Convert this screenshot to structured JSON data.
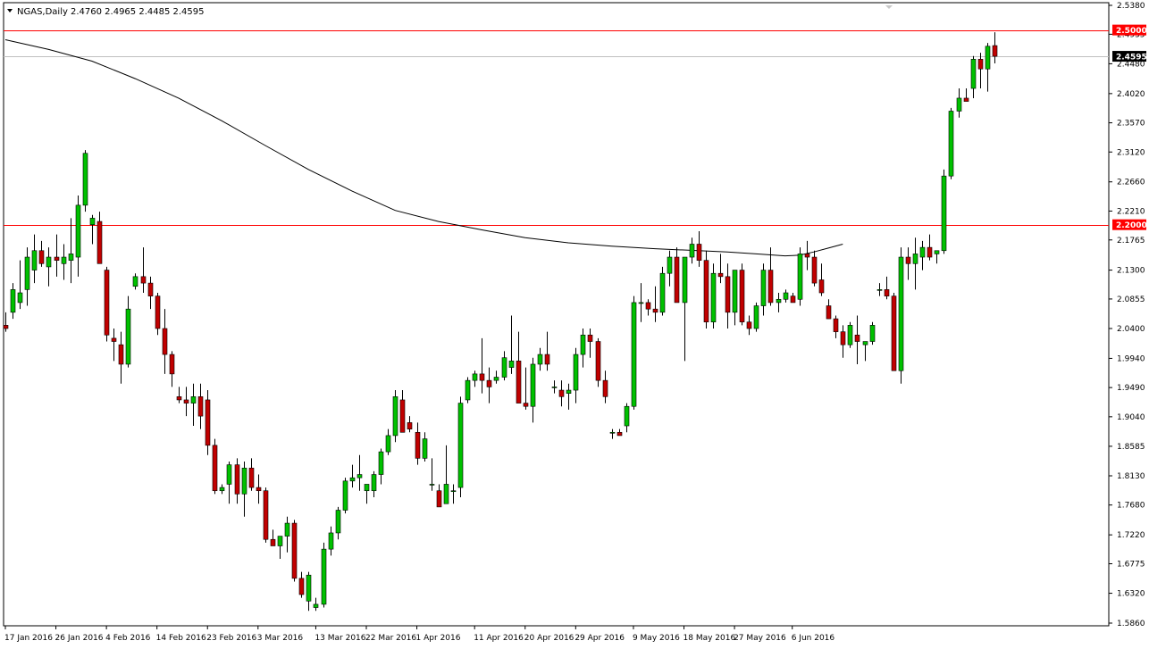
{
  "chart_data": {
    "type": "candlestick",
    "symbol_header": "NGAS,Daily",
    "ohlc_header": "2.4760 2.4965 2.4485 2.4595",
    "y_axis": {
      "ticks": [
        "2.5380",
        "2.4935",
        "2.4480",
        "2.4020",
        "2.3570",
        "2.3120",
        "2.2660",
        "2.2210",
        "2.1765",
        "2.1300",
        "2.0855",
        "2.0400",
        "1.9940",
        "1.9490",
        "1.9040",
        "1.8585",
        "1.8130",
        "1.7680",
        "1.7220",
        "1.6775",
        "1.6320",
        "1.5860"
      ],
      "range": [
        1.586,
        2.538
      ]
    },
    "x_axis": {
      "labels": [
        {
          "text": "17 Jan 2016",
          "index": 0
        },
        {
          "text": "26 Jan 2016",
          "index": 7
        },
        {
          "text": "4 Feb 2016",
          "index": 14
        },
        {
          "text": "14 Feb 2016",
          "index": 21
        },
        {
          "text": "23 Feb 2016",
          "index": 28
        },
        {
          "text": "3 Mar 2016",
          "index": 35
        },
        {
          "text": "13 Mar 2016",
          "index": 43
        },
        {
          "text": "22 Mar 2016",
          "index": 50
        },
        {
          "text": "1 Apr 2016",
          "index": 57
        },
        {
          "text": "11 Apr 2016",
          "index": 65
        },
        {
          "text": "20 Apr 2016",
          "index": 72
        },
        {
          "text": "29 Apr 2016",
          "index": 79
        },
        {
          "text": "9 May 2016",
          "index": 87
        },
        {
          "text": "18 May 2016",
          "index": 94
        },
        {
          "text": "27 May 2016",
          "index": 101
        },
        {
          "text": "6 Jun 2016",
          "index": 109
        }
      ]
    },
    "horizontal_lines": [
      {
        "price": 2.5,
        "label": "2.5000",
        "color": "#ff0000",
        "label_bg": "#ff0000",
        "label_color": "#ffffff"
      },
      {
        "price": 2.2,
        "label": "2.2000",
        "color": "#ff0000",
        "label_bg": "#ff0000",
        "label_color": "#ffffff"
      },
      {
        "price": 2.4595,
        "label": "2.4595",
        "color": "#c0c0c0",
        "label_bg": "#000000",
        "label_color": "#ffffff"
      }
    ],
    "colors": {
      "bull": "#00c000",
      "bear": "#c00000",
      "wick": "#000000",
      "ma": "#000000",
      "background": "#ffffff"
    },
    "candles": [
      [
        2.045,
        2.065,
        2.035,
        2.04
      ],
      [
        2.065,
        2.11,
        2.055,
        2.1
      ],
      [
        2.08,
        2.145,
        2.07,
        2.095
      ],
      [
        2.1,
        2.165,
        2.075,
        2.15
      ],
      [
        2.13,
        2.185,
        2.11,
        2.16
      ],
      [
        2.16,
        2.175,
        2.135,
        2.14
      ],
      [
        2.135,
        2.165,
        2.105,
        2.15
      ],
      [
        2.15,
        2.185,
        2.12,
        2.145
      ],
      [
        2.14,
        2.17,
        2.115,
        2.15
      ],
      [
        2.145,
        2.21,
        2.11,
        2.155
      ],
      [
        2.15,
        2.245,
        2.12,
        2.23
      ],
      [
        2.23,
        2.315,
        2.22,
        2.31
      ],
      [
        2.2,
        2.215,
        2.17,
        2.21
      ],
      [
        2.205,
        2.22,
        2.14,
        2.14
      ],
      [
        2.13,
        2.135,
        2.02,
        2.03
      ],
      [
        2.025,
        2.04,
        1.99,
        2.02
      ],
      [
        2.015,
        2.035,
        1.955,
        1.985
      ],
      [
        1.985,
        2.09,
        1.98,
        2.07
      ],
      [
        2.105,
        2.125,
        2.1,
        2.12
      ],
      [
        2.12,
        2.165,
        2.095,
        2.11
      ],
      [
        2.11,
        2.12,
        2.07,
        2.09
      ],
      [
        2.09,
        2.095,
        2.03,
        2.04
      ],
      [
        2.04,
        2.07,
        1.97,
        2.0
      ],
      [
        2.0,
        2.005,
        1.95,
        1.97
      ],
      [
        1.935,
        1.95,
        1.925,
        1.93
      ],
      [
        1.93,
        1.95,
        1.905,
        1.925
      ],
      [
        1.925,
        1.955,
        1.89,
        1.935
      ],
      [
        1.935,
        1.955,
        1.885,
        1.905
      ],
      [
        1.93,
        1.945,
        1.845,
        1.86
      ],
      [
        1.86,
        1.87,
        1.785,
        1.79
      ],
      [
        1.79,
        1.8,
        1.785,
        1.795
      ],
      [
        1.8,
        1.835,
        1.77,
        1.83
      ],
      [
        1.83,
        1.84,
        1.77,
        1.785
      ],
      [
        1.785,
        1.835,
        1.75,
        1.825
      ],
      [
        1.825,
        1.84,
        1.79,
        1.795
      ],
      [
        1.795,
        1.815,
        1.77,
        1.79
      ],
      [
        1.79,
        1.795,
        1.71,
        1.715
      ],
      [
        1.715,
        1.73,
        1.705,
        1.705
      ],
      [
        1.705,
        1.715,
        1.685,
        1.72
      ],
      [
        1.72,
        1.75,
        1.695,
        1.74
      ],
      [
        1.74,
        1.745,
        1.65,
        1.655
      ],
      [
        1.655,
        1.665,
        1.625,
        1.63
      ],
      [
        1.62,
        1.665,
        1.605,
        1.66
      ],
      [
        1.61,
        1.625,
        1.605,
        1.615
      ],
      [
        1.615,
        1.71,
        1.61,
        1.7
      ],
      [
        1.7,
        1.735,
        1.69,
        1.725
      ],
      [
        1.725,
        1.765,
        1.715,
        1.76
      ],
      [
        1.76,
        1.81,
        1.755,
        1.805
      ],
      [
        1.805,
        1.83,
        1.795,
        1.81
      ],
      [
        1.81,
        1.845,
        1.79,
        1.815
      ],
      [
        1.79,
        1.8,
        1.77,
        1.8
      ],
      [
        1.79,
        1.82,
        1.78,
        1.815
      ],
      [
        1.815,
        1.855,
        1.8,
        1.85
      ],
      [
        1.85,
        1.885,
        1.845,
        1.875
      ],
      [
        1.875,
        1.945,
        1.865,
        1.935
      ],
      [
        1.93,
        1.945,
        1.88,
        1.88
      ],
      [
        1.895,
        1.905,
        1.88,
        1.885
      ],
      [
        1.88,
        1.895,
        1.83,
        1.84
      ],
      [
        1.84,
        1.88,
        1.835,
        1.87
      ],
      [
        1.8,
        1.84,
        1.79,
        1.8
      ],
      [
        1.79,
        1.8,
        1.765,
        1.765
      ],
      [
        1.77,
        1.86,
        1.77,
        1.8
      ],
      [
        1.79,
        1.8,
        1.77,
        1.79
      ],
      [
        1.795,
        1.935,
        1.78,
        1.925
      ],
      [
        1.93,
        1.965,
        1.925,
        1.96
      ],
      [
        1.96,
        1.975,
        1.95,
        1.97
      ],
      [
        1.97,
        2.025,
        1.94,
        1.96
      ],
      [
        1.96,
        1.98,
        1.925,
        1.95
      ],
      [
        1.96,
        1.975,
        1.955,
        1.965
      ],
      [
        1.965,
        2.005,
        1.96,
        1.995
      ],
      [
        1.98,
        2.06,
        1.97,
        1.99
      ],
      [
        1.99,
        2.035,
        1.93,
        1.925
      ],
      [
        1.925,
        1.98,
        1.915,
        1.92
      ],
      [
        1.92,
        1.995,
        1.895,
        1.985
      ],
      [
        1.985,
        2.01,
        1.975,
        2.0
      ],
      [
        2.0,
        2.035,
        1.975,
        1.985
      ],
      [
        1.95,
        1.96,
        1.94,
        1.95
      ],
      [
        1.945,
        1.96,
        1.92,
        1.935
      ],
      [
        1.94,
        1.955,
        1.915,
        1.945
      ],
      [
        1.945,
        2.01,
        1.925,
        2.0
      ],
      [
        2.0,
        2.04,
        1.98,
        2.03
      ],
      [
        2.03,
        2.04,
        1.995,
        2.02
      ],
      [
        2.02,
        2.025,
        1.95,
        1.96
      ],
      [
        1.96,
        1.975,
        1.925,
        1.935
      ],
      [
        1.88,
        1.885,
        1.87,
        1.88
      ],
      [
        1.88,
        1.885,
        1.875,
        1.875
      ],
      [
        1.89,
        1.925,
        1.88,
        1.92
      ],
      [
        1.92,
        2.09,
        1.915,
        2.08
      ],
      [
        2.08,
        2.11,
        2.05,
        2.08
      ],
      [
        2.08,
        2.085,
        2.06,
        2.07
      ],
      [
        2.07,
        2.105,
        2.05,
        2.065
      ],
      [
        2.065,
        2.135,
        2.06,
        2.125
      ],
      [
        2.125,
        2.16,
        2.105,
        2.15
      ],
      [
        2.15,
        2.165,
        2.09,
        2.08
      ],
      [
        2.08,
        2.095,
        1.99,
        2.15
      ],
      [
        2.15,
        2.18,
        2.14,
        2.17
      ],
      [
        2.17,
        2.19,
        2.135,
        2.145
      ],
      [
        2.145,
        2.16,
        2.04,
        2.05
      ],
      [
        2.05,
        2.14,
        2.04,
        2.125
      ],
      [
        2.125,
        2.155,
        2.11,
        2.12
      ],
      [
        2.12,
        2.14,
        2.04,
        2.065
      ],
      [
        2.065,
        2.13,
        2.045,
        2.13
      ],
      [
        2.13,
        2.14,
        2.045,
        2.05
      ],
      [
        2.05,
        2.06,
        2.03,
        2.04
      ],
      [
        2.04,
        2.08,
        2.035,
        2.075
      ],
      [
        2.075,
        2.14,
        2.06,
        2.13
      ],
      [
        2.13,
        2.165,
        2.075,
        2.08
      ],
      [
        2.08,
        2.095,
        2.065,
        2.085
      ],
      [
        2.085,
        2.1,
        2.08,
        2.095
      ],
      [
        2.09,
        2.095,
        2.08,
        2.08
      ],
      [
        2.085,
        2.165,
        2.075,
        2.155
      ],
      [
        2.155,
        2.175,
        2.13,
        2.15
      ],
      [
        2.15,
        2.16,
        2.105,
        2.11
      ],
      [
        2.115,
        2.14,
        2.09,
        2.095
      ],
      [
        2.075,
        2.085,
        2.055,
        2.055
      ],
      [
        2.055,
        2.06,
        2.025,
        2.035
      ],
      [
        2.035,
        2.045,
        1.995,
        2.015
      ],
      [
        2.015,
        2.05,
        2.01,
        2.045
      ],
      [
        2.03,
        2.06,
        1.985,
        2.02
      ],
      [
        2.015,
        2.02,
        1.99,
        2.02
      ],
      [
        2.02,
        2.05,
        2.015,
        2.045
      ],
      [
        2.1,
        2.11,
        2.09,
        2.1
      ],
      [
        2.1,
        2.12,
        2.085,
        2.09
      ],
      [
        2.09,
        2.095,
        1.985,
        1.975
      ],
      [
        1.975,
        2.165,
        1.955,
        2.15
      ],
      [
        2.15,
        2.165,
        2.115,
        2.14
      ],
      [
        2.14,
        2.18,
        2.1,
        2.155
      ],
      [
        2.15,
        2.175,
        2.13,
        2.165
      ],
      [
        2.165,
        2.185,
        2.145,
        2.15
      ],
      [
        2.155,
        2.16,
        2.14,
        2.16
      ],
      [
        2.16,
        2.285,
        2.155,
        2.275
      ],
      [
        2.275,
        2.38,
        2.27,
        2.375
      ],
      [
        2.375,
        2.41,
        2.365,
        2.395
      ],
      [
        2.395,
        2.41,
        2.39,
        2.39
      ],
      [
        2.41,
        2.46,
        2.395,
        2.455
      ],
      [
        2.455,
        2.465,
        2.41,
        2.44
      ],
      [
        2.44,
        2.48,
        2.405,
        2.475
      ],
      [
        2.476,
        2.4965,
        2.4485,
        2.4595
      ]
    ],
    "moving_average": [
      [
        0,
        2.485
      ],
      [
        6,
        2.47
      ],
      [
        12,
        2.452
      ],
      [
        18,
        2.425
      ],
      [
        24,
        2.395
      ],
      [
        30,
        2.36
      ],
      [
        36,
        2.322
      ],
      [
        42,
        2.285
      ],
      [
        48,
        2.252
      ],
      [
        54,
        2.222
      ],
      [
        60,
        2.205
      ],
      [
        66,
        2.192
      ],
      [
        72,
        2.18
      ],
      [
        78,
        2.172
      ],
      [
        84,
        2.167
      ],
      [
        90,
        2.163
      ],
      [
        96,
        2.16
      ],
      [
        100,
        2.158
      ],
      [
        104,
        2.155
      ],
      [
        108,
        2.152
      ],
      [
        110,
        2.153
      ],
      [
        112,
        2.158
      ],
      [
        114,
        2.164
      ],
      [
        116,
        2.17
      ]
    ]
  }
}
